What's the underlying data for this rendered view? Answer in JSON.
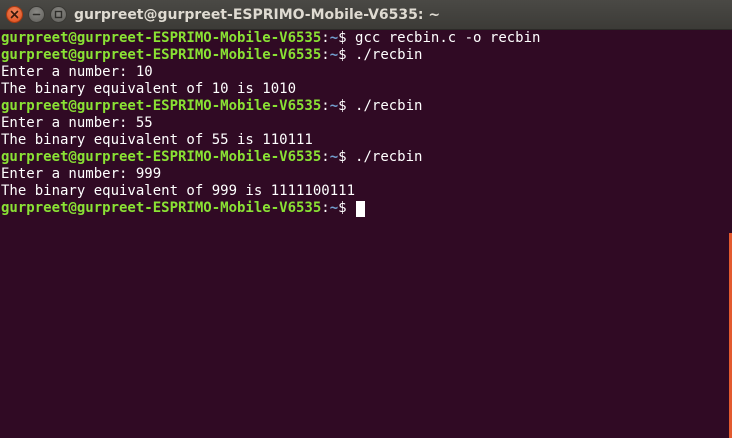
{
  "window": {
    "title": "gurpreet@gurpreet-ESPRIMO-Mobile-V6535: ~"
  },
  "terminal": {
    "lines": [
      {
        "type": "prompt",
        "user": "gurpreet@gurpreet-ESPRIMO-Mobile-V6535",
        "sep": ":",
        "path": "~",
        "symbol": "$",
        "command": " gcc recbin.c -o recbin"
      },
      {
        "type": "prompt",
        "user": "gurpreet@gurpreet-ESPRIMO-Mobile-V6535",
        "sep": ":",
        "path": "~",
        "symbol": "$",
        "command": " ./recbin"
      },
      {
        "type": "output",
        "text": "Enter a number: 10"
      },
      {
        "type": "output",
        "text": "The binary equivalent of 10 is 1010"
      },
      {
        "type": "prompt",
        "user": "gurpreet@gurpreet-ESPRIMO-Mobile-V6535",
        "sep": ":",
        "path": "~",
        "symbol": "$",
        "command": " ./recbin"
      },
      {
        "type": "output",
        "text": "Enter a number: 55"
      },
      {
        "type": "output",
        "text": "The binary equivalent of 55 is 110111"
      },
      {
        "type": "prompt",
        "user": "gurpreet@gurpreet-ESPRIMO-Mobile-V6535",
        "sep": ":",
        "path": "~",
        "symbol": "$",
        "command": " ./recbin"
      },
      {
        "type": "output",
        "text": "Enter a number: 999"
      },
      {
        "type": "output",
        "text": "The binary equivalent of 999 is 1111100111"
      },
      {
        "type": "prompt",
        "user": "gurpreet@gurpreet-ESPRIMO-Mobile-V6535",
        "sep": ":",
        "path": "~",
        "symbol": "$",
        "command": " "
      }
    ]
  },
  "colors": {
    "background": "#300a24",
    "prompt_user": "#8ae234",
    "prompt_path": "#729fcf",
    "text": "#ffffff",
    "scrollbar": "#e35a2f"
  },
  "icons": {
    "close": "close-icon",
    "minimize": "minimize-icon",
    "maximize": "maximize-icon"
  }
}
